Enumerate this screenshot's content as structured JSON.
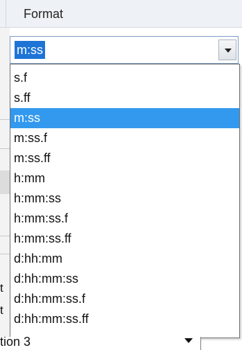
{
  "header": {
    "title": "Format"
  },
  "format_combo": {
    "value": "m:ss"
  },
  "format_options": [
    "s.f",
    "s.ff",
    "m:ss",
    "m:ss.f",
    "m:ss.ff",
    "h:mm",
    "h:mm:ss",
    "h:mm:ss.f",
    "h:mm:ss.ff",
    "d:hh:mm",
    "d:hh:mm:ss",
    "d:hh:mm:ss.f",
    "d:hh:mm:ss.ff"
  ],
  "selected_option": "m:ss",
  "background": {
    "bottom_combo_text": "tion 3",
    "letter_1": "t",
    "letter_2": "t"
  },
  "colors": {
    "selection": "#3399ee",
    "combo_selection": "#1e74d6",
    "header_bg": "#eef1f5"
  },
  "icons": {
    "combo_arrow": "chevron-down-icon"
  }
}
